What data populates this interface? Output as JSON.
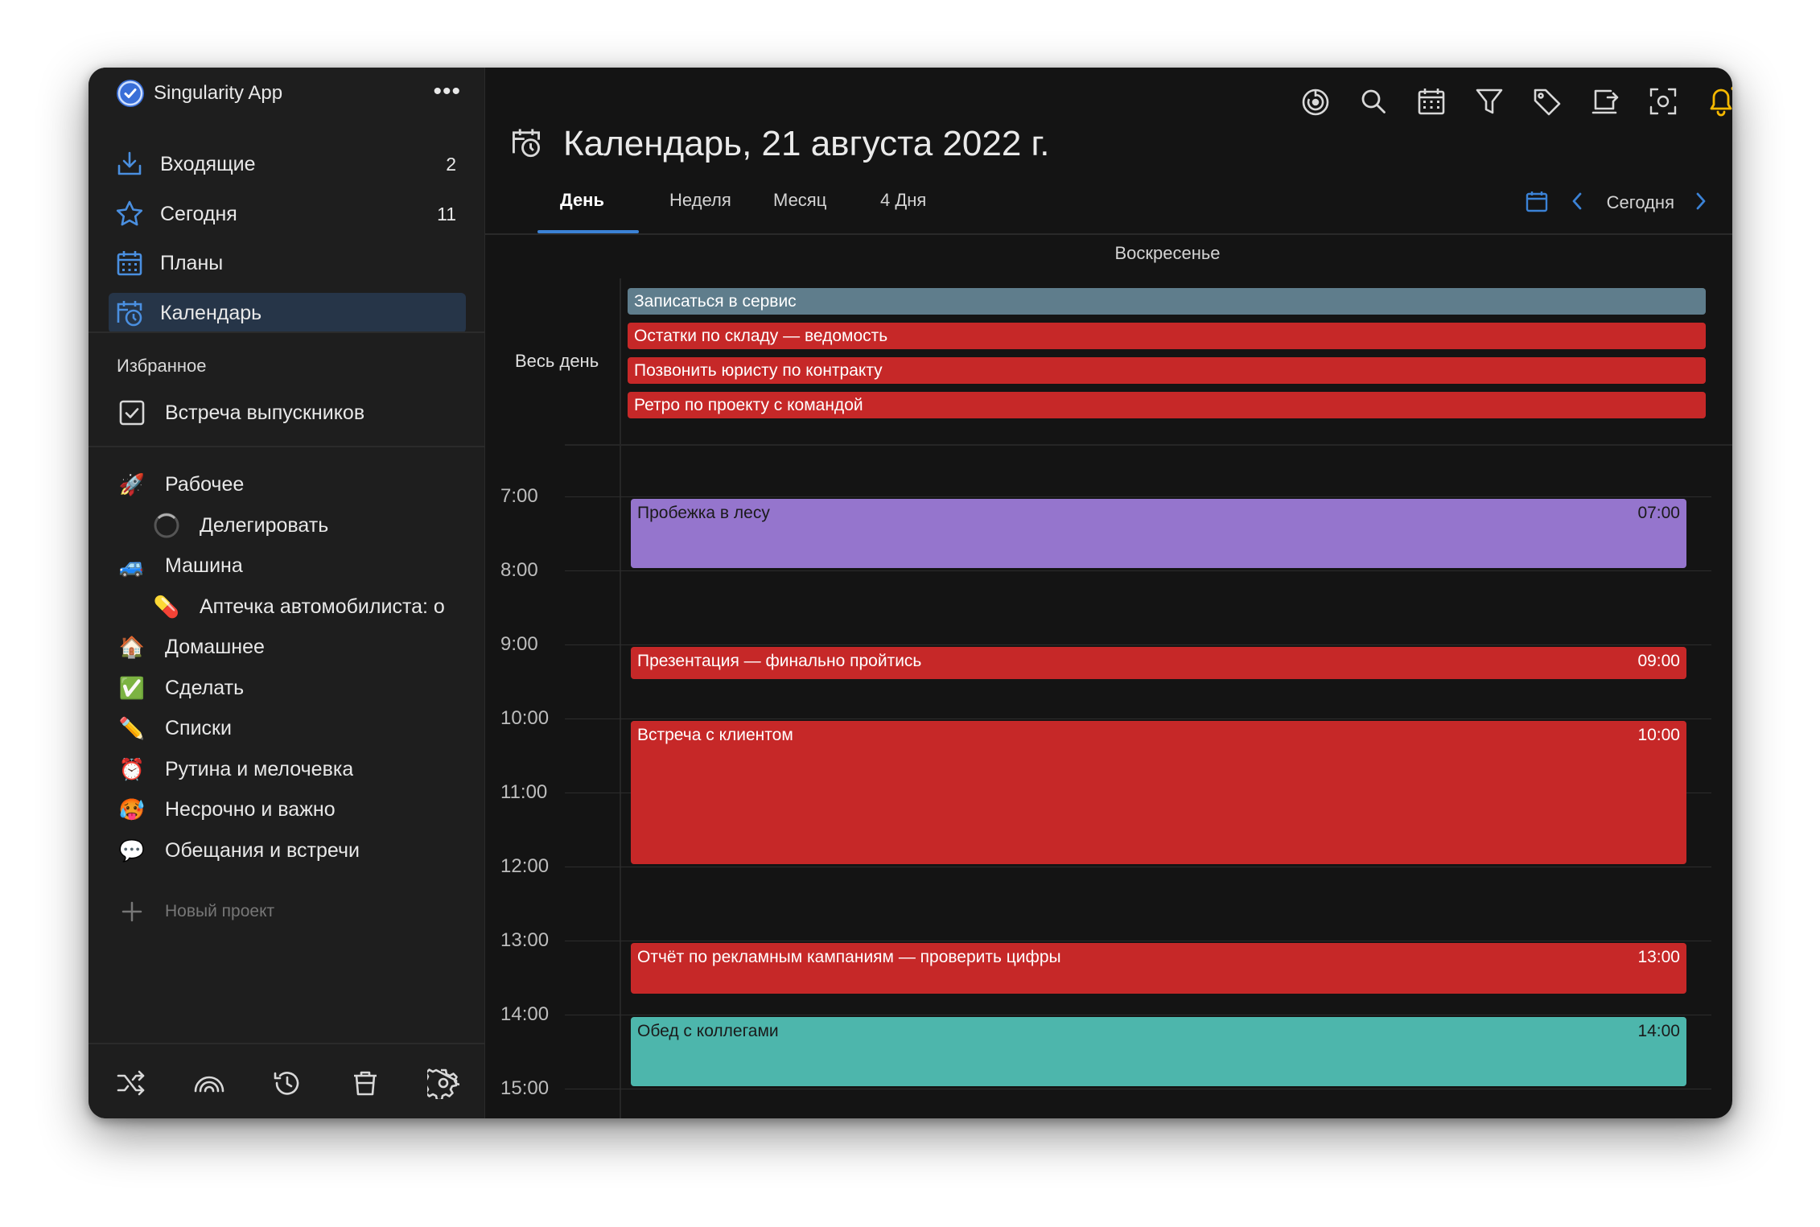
{
  "app": {
    "name": "Singularity App",
    "more": "•••"
  },
  "sidebar": {
    "nav": [
      {
        "label": "Входящие",
        "count": "2",
        "icon": "inbox-icon"
      },
      {
        "label": "Сегодня",
        "count": "11",
        "icon": "star-icon"
      },
      {
        "label": "Планы",
        "count": "",
        "icon": "plans-calendar-icon"
      },
      {
        "label": "Календарь",
        "count": "",
        "icon": "calendar-clock-icon"
      }
    ],
    "favorites_title": "Избранное",
    "favorites": [
      {
        "label": "Встреча выпускников",
        "icon": "checkbox-icon"
      }
    ],
    "projects": [
      {
        "label": "Рабочее",
        "icon": "🚀",
        "level": 0
      },
      {
        "label": "Делегировать",
        "icon": "circle-outline-icon",
        "level": 1
      },
      {
        "label": "Машина",
        "icon": "🚙",
        "level": 0
      },
      {
        "label": "Аптечка автомобилиста: о",
        "icon": "💊",
        "level": 1
      },
      {
        "label": "Домашнее",
        "icon": "🏠",
        "level": 0
      },
      {
        "label": "Сделать",
        "icon": "✅",
        "level": 0
      },
      {
        "label": "Списки",
        "icon": "✏️",
        "level": 0
      },
      {
        "label": "Рутина и мелочевка",
        "icon": "⏰",
        "level": 0
      },
      {
        "label": "Несрочно и важно",
        "icon": "🥵",
        "level": 0
      },
      {
        "label": "Обещания и встречи",
        "icon": "💬",
        "level": 0
      }
    ],
    "new_project": "Новый проект",
    "bottom_icons": [
      "shuffle-icon",
      "rainbow-icon",
      "history-icon",
      "trash-icon",
      "settings-icon"
    ]
  },
  "toolbar": {
    "icons": [
      "focus-icon",
      "search-icon",
      "calendar-grid-icon",
      "filter-icon",
      "tag-icon",
      "export-icon",
      "screenshot-icon",
      "bell-icon",
      "timer-icon"
    ]
  },
  "main": {
    "title": "Календарь, 21 августа 2022 г.",
    "tabs": [
      "День",
      "Неделя",
      "Месяц",
      "4 Дня"
    ],
    "active_tab": "День",
    "today": "Сегодня",
    "day_name": "Воскресенье",
    "all_day_label": "Весь день"
  },
  "all_day_events": [
    {
      "title": "Записаться в сервис",
      "color": "#5f7d8c"
    },
    {
      "title": "Остатки по складу — ведомость",
      "color": "#c62828"
    },
    {
      "title": "Позвонить юристу по контракту",
      "color": "#c62828"
    },
    {
      "title": "Ретро по проекту с командой",
      "color": "#c62828"
    }
  ],
  "hours": [
    "7:00",
    "8:00",
    "9:00",
    "10:00",
    "11:00",
    "12:00",
    "13:00",
    "14:00",
    "15:00"
  ],
  "events": [
    {
      "title": "Пробежка в лесу",
      "time": "07:00",
      "start": "07:00",
      "end": "08:00",
      "color": "#9575cd",
      "text_color": "#1a1a1a"
    },
    {
      "title": "Презентация — финально пройтись",
      "time": "09:00",
      "start": "09:00",
      "end": "09:30",
      "color": "#c62828",
      "text_color": "#ffffff"
    },
    {
      "title": "Встреча с клиентом",
      "time": "10:00",
      "start": "10:00",
      "end": "12:00",
      "color": "#c62828",
      "text_color": "#ffffff"
    },
    {
      "title": "Отчёт по рекламным кампаниям — проверить цифры",
      "time": "13:00",
      "start": "13:00",
      "end": "13:45",
      "color": "#c62828",
      "text_color": "#ffffff"
    },
    {
      "title": "Обед с коллегами",
      "time": "14:00",
      "start": "14:00",
      "end": "15:00",
      "color": "#4db6ac",
      "text_color": "#1a1a1a"
    }
  ],
  "colors": {
    "accent": "#3b82d6",
    "bell": "#f5b800",
    "sidebar_active": "#263548"
  }
}
